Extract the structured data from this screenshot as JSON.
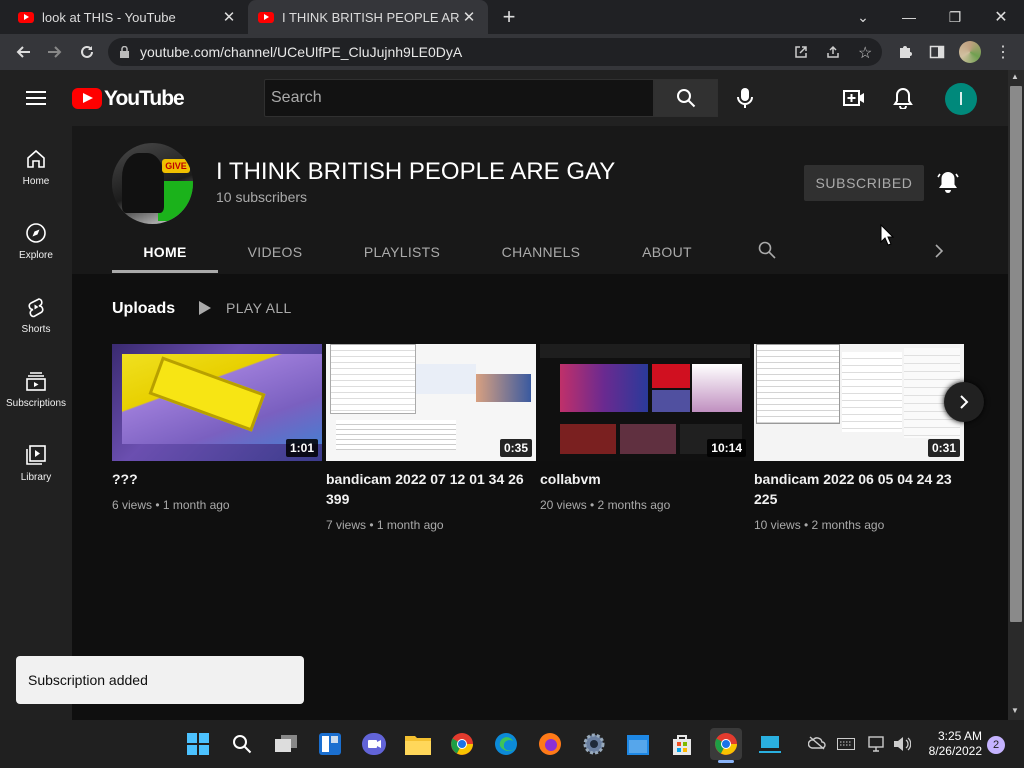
{
  "browser": {
    "tabs": [
      {
        "title": "look at THIS - YouTube"
      },
      {
        "title": "I THINK BRITISH PEOPLE ARE GAY"
      }
    ],
    "url": "youtube.com/channel/UCeUlfPE_CluJujnh9LE0DyA"
  },
  "youtube": {
    "logo_text": "YouTube",
    "search_placeholder": "Search",
    "avatar_letter": "I",
    "accent_color": "#ff0000"
  },
  "sidebar": {
    "items": [
      {
        "label": "Home",
        "icon": "home-icon"
      },
      {
        "label": "Explore",
        "icon": "compass-icon"
      },
      {
        "label": "Shorts",
        "icon": "shorts-icon"
      },
      {
        "label": "Subscriptions",
        "icon": "subscriptions-icon"
      },
      {
        "label": "Library",
        "icon": "library-icon"
      }
    ]
  },
  "channel": {
    "name": "I THINK BRITISH PEOPLE ARE GAY",
    "subscribers": "10 subscribers",
    "subscribe_label": "SUBSCRIBED",
    "tabs": [
      "HOME",
      "VIDEOS",
      "PLAYLISTS",
      "CHANNELS",
      "ABOUT"
    ],
    "active_tab": "HOME",
    "avatar_badge": "GIVE"
  },
  "uploads": {
    "heading": "Uploads",
    "play_all": "PLAY ALL",
    "videos": [
      {
        "title": "???",
        "duration": "1:01",
        "meta": "6 views • 1 month ago"
      },
      {
        "title": "bandicam 2022 07 12 01 34 26 399",
        "duration": "0:35",
        "meta": "7 views • 1 month ago"
      },
      {
        "title": "collabvm",
        "duration": "10:14",
        "meta": "20 views • 2 months ago"
      },
      {
        "title": "bandicam 2022 06 05 04 24 23 225",
        "duration": "0:31",
        "meta": "10 views • 2 months ago"
      }
    ]
  },
  "toast": {
    "text": "Subscription added"
  },
  "taskbar": {
    "time": "3:25 AM",
    "date": "8/26/2022",
    "notification_count": "2"
  }
}
